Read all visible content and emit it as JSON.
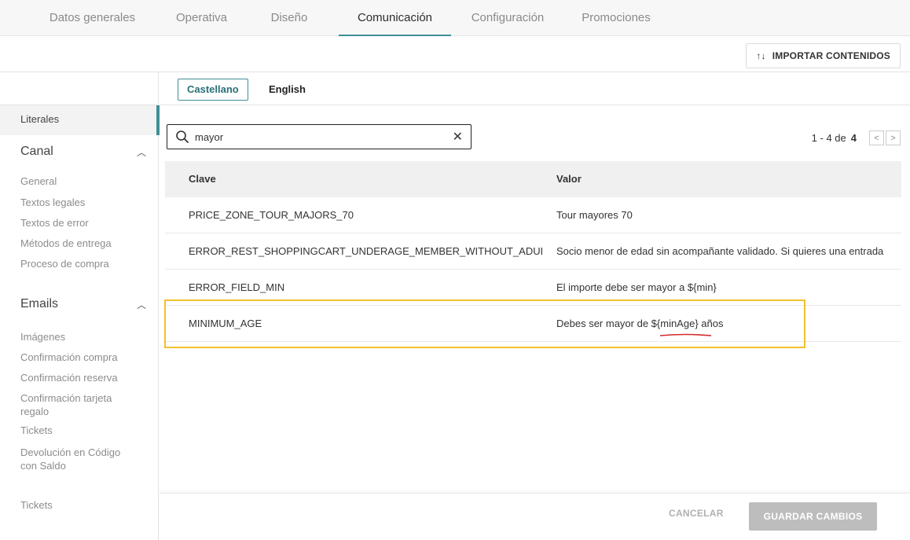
{
  "top_tabs": [
    "Datos generales",
    "Operativa",
    "Diseño",
    "Comunicación",
    "Configuración",
    "Promociones"
  ],
  "toolbar": {
    "import_label": "IMPORTAR CONTENIDOS",
    "import_icon": "sort-arrows-icon"
  },
  "sidebar": {
    "active_item": "Literales",
    "canal": {
      "title": "Canal",
      "items": [
        "General",
        "Textos legales",
        "Textos de error",
        "Métodos de entrega",
        "Proceso de compra"
      ]
    },
    "emails": {
      "title": "Emails",
      "items": [
        "Imágenes",
        "Confirmación compra",
        "Confirmación reserva",
        "Confirmación tarjeta regalo",
        "Tickets",
        "Devolución en Código con Saldo"
      ]
    },
    "tickets": "Tickets"
  },
  "languages": {
    "active": "Castellano",
    "other": "English"
  },
  "search": {
    "value": "mayor",
    "icon": "search-icon",
    "clear_icon": "close-icon"
  },
  "pager": {
    "range": "1 - 4 de",
    "total": "4"
  },
  "table": {
    "headers": {
      "key": "Clave",
      "value": "Valor"
    },
    "rows": [
      {
        "key": "PRICE_ZONE_TOUR_MAJORS_70",
        "value": "Tour mayores 70"
      },
      {
        "key": "ERROR_REST_SHOPPINGCART_UNDERAGE_MEMBER_WITHOUT_ADULT",
        "value": "Socio menor de edad sin acompañante validado. Si quieres una entrada"
      },
      {
        "key": "ERROR_FIELD_MIN",
        "value": "El importe debe ser mayor a ${min}"
      },
      {
        "key": "MINIMUM_AGE",
        "value": "Debes ser mayor de ${minAge} años"
      }
    ]
  },
  "footer": {
    "cancel": "CANCELAR",
    "save": "GUARDAR CAMBIOS"
  },
  "colors": {
    "accent": "#3f8f97",
    "highlight": "#f2c12e",
    "underline": "#d42b2b"
  }
}
